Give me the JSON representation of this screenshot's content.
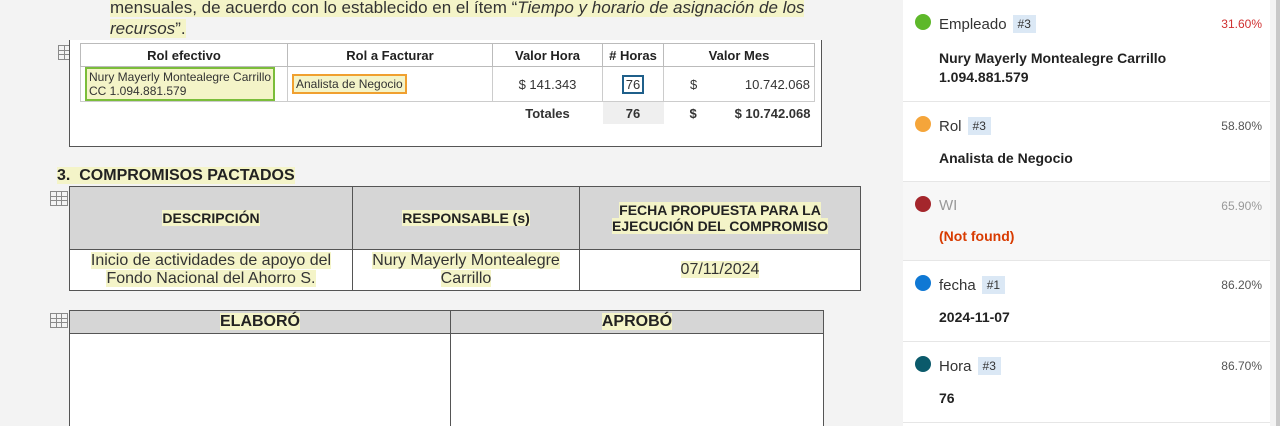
{
  "document": {
    "intro_line1_plain": "mensuales, de acuerdo con lo establecido en el ítem “",
    "intro_line1_italic": "Tiempo y horario de asignación de los",
    "intro_line2_italic": "recursos",
    "intro_line2_end": "”.",
    "billing_table": {
      "headers": [
        "Rol efectivo",
        "Rol a Facturar",
        "Valor Hora",
        "# Horas",
        "Valor Mes"
      ],
      "row": {
        "employee_name": "Nury Mayerly Montealegre Carrillo",
        "employee_id": "CC 1.094.881.579",
        "role": "Analista de Negocio",
        "hour_value": "$ 141.343",
        "hours": "76",
        "currency": "$",
        "month_value": "10.742.068"
      },
      "totals": {
        "label": "Totales",
        "hours": "76",
        "currency": "$",
        "value": "$ 10.742.068"
      }
    },
    "section3": {
      "number": "3.",
      "title": "COMPROMISOS PACTADOS",
      "headers": [
        "DESCRIPCIÓN",
        "RESPONSABLE (s)",
        "FECHA PROPUESTA PARA LA EJECUCIÓN DEL COMPROMISO"
      ],
      "row": {
        "description": "Inicio de actividades de apoyo del Fondo Nacional del Ahorro S.",
        "responsible": "Nury Mayerly Montealegre Carrillo",
        "date": "07/11/2024"
      }
    },
    "signatures": {
      "headers": [
        "ELABORÓ",
        "APROBÓ"
      ]
    }
  },
  "fields": [
    {
      "name": "Empleado",
      "badge": "#3",
      "confidence": "31.60%",
      "value_line1": "Nury Mayerly Montealegre Carrillo",
      "value_line2": "1.094.881.579",
      "color": "#5eb82a",
      "pct_color": "#d03030",
      "name_color": "#333333",
      "value_color": "#222222"
    },
    {
      "name": "Rol",
      "badge": "#3",
      "confidence": "58.80%",
      "value_line1": "Analista de Negocio",
      "value_line2": "",
      "color": "#f5a53a",
      "pct_color": "#555555",
      "name_color": "#333333",
      "value_color": "#222222"
    },
    {
      "name": "WI",
      "badge": "",
      "confidence": "65.90%",
      "value_line1": "(Not found)",
      "value_line2": "",
      "color": "#a4262c",
      "pct_color": "#999999",
      "name_color": "#999999",
      "value_color": "#d83b01"
    },
    {
      "name": "fecha",
      "badge": "#1",
      "confidence": "86.20%",
      "value_line1": "2024-11-07",
      "value_line2": "",
      "color": "#0f78d4",
      "pct_color": "#555555",
      "name_color": "#333333",
      "value_color": "#222222"
    },
    {
      "name": "Hora",
      "badge": "#3",
      "confidence": "86.70%",
      "value_line1": "76",
      "value_line2": "",
      "color": "#0b5a6b",
      "pct_color": "#555555",
      "name_color": "#333333",
      "value_color": "#222222"
    }
  ]
}
